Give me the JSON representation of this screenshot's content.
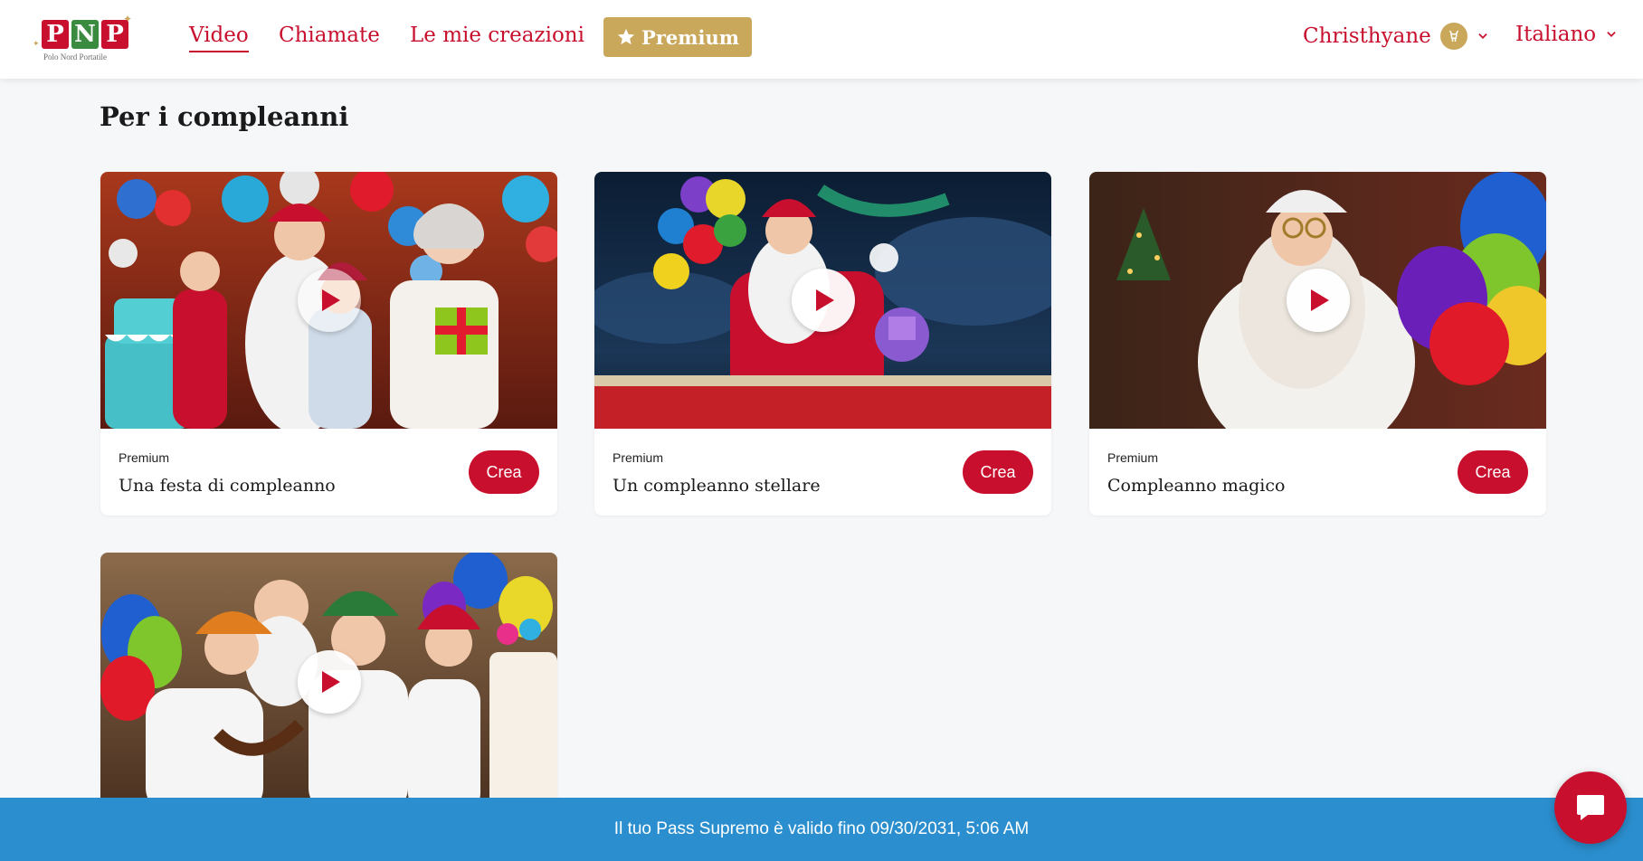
{
  "header": {
    "logo": {
      "letters": [
        "P",
        "N",
        "P"
      ],
      "subtitle": "Polo Nord Portatile"
    },
    "nav": {
      "video": "Video",
      "calls": "Chiamate",
      "creations": "Le mie creazioni",
      "premium": "Premium"
    },
    "user": {
      "name": "Christhyane"
    },
    "language": "Italiano"
  },
  "section": {
    "title": "Per i compleanni"
  },
  "cards": [
    {
      "tier": "Premium",
      "title": "Una festa di compleanno",
      "cta": "Crea"
    },
    {
      "tier": "Premium",
      "title": "Un compleanno stellare",
      "cta": "Crea"
    },
    {
      "tier": "Premium",
      "title": "Compleanno magico",
      "cta": "Crea"
    },
    {
      "tier": "",
      "title": "",
      "cta": ""
    }
  ],
  "banner": {
    "text": "Il tuo Pass Supremo è valido fino 09/30/2031, 5:06 AM"
  },
  "colors": {
    "brand_red": "#c8102e",
    "gold": "#c9a85b",
    "banner_blue": "#2b8fcf",
    "logo_green": "#3a8a3f"
  },
  "icons": {
    "premium": "star-icon",
    "user_badge": "reindeer-icon",
    "dropdown": "chevron-down-icon",
    "play": "play-icon",
    "chat": "chat-bubble-icon"
  }
}
